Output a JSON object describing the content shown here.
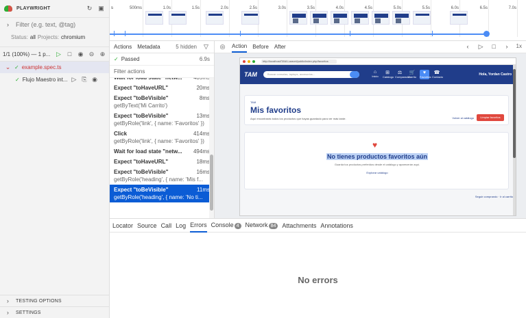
{
  "sidebar": {
    "title": "PLAYWRIGHT",
    "filter_placeholder": "Filter (e.g. text, @tag)",
    "status_label": "Status:",
    "status_value": "all",
    "projects_label": "Projects:",
    "projects_value": "chromium",
    "run_count": "1/1 (100%) — 1 p...",
    "file": "example.spec.ts",
    "test": "Flujo Maestro int...",
    "testing_options": "TESTING OPTIONS",
    "settings": "SETTINGS"
  },
  "timeline": {
    "ticks": [
      "500ms",
      "1.0s",
      "1.5s",
      "2.0s",
      "2.5s",
      "3.0s",
      "3.5s",
      "4.0s",
      "4.5s",
      "5.0s",
      "5.5s",
      "6.0s",
      "6.5s",
      "7.0s"
    ],
    "first_label": "s"
  },
  "actions_panel": {
    "tab_actions": "Actions",
    "tab_metadata": "Metadata",
    "hidden": "5 hidden",
    "passed": "Passed",
    "passed_time": "6.9s",
    "filter": "Filter actions",
    "items": [
      {
        "name": "Wait for load state \"netw...",
        "ms": "435ms",
        "sub": ""
      },
      {
        "name": "Expect \"toHaveURL\"",
        "ms": "20ms",
        "sub": ""
      },
      {
        "name": "Expect \"toBeVisible\"",
        "ms": "8ms",
        "sub": "getByText('Mi Carrito')"
      },
      {
        "name": "Expect \"toBeVisible\"",
        "ms": "13ms",
        "sub": "getByRole('link', { name: 'Favoritos' })"
      },
      {
        "name": "Click",
        "ms": "414ms",
        "sub": "getByRole('link', { name: 'Favoritos' })"
      },
      {
        "name": "Wait for load state \"netw...",
        "ms": "494ms",
        "sub": ""
      },
      {
        "name": "Expect \"toHaveURL\"",
        "ms": "18ms",
        "sub": ""
      },
      {
        "name": "Expect \"toBeVisible\"",
        "ms": "16ms",
        "sub": "getByRole('heading', { name: 'Mis f..."
      },
      {
        "name": "Expect \"toBeVisible\"",
        "ms": "11ms",
        "sub": "getByRole('heading', { name: 'No ti..."
      }
    ]
  },
  "main": {
    "tab_action": "Action",
    "tab_before": "Before",
    "tab_after": "After",
    "zoom": "1x"
  },
  "snapshot": {
    "url": "http://localhost/TAM-Laravel/public/index.php/favoritos",
    "brand": "TAM",
    "search_placeholder": "Buscar consolas, laptops, accesorios...",
    "nav": [
      "Inicio",
      "Catálogo",
      "Comparador",
      "Carrito",
      "Favoritos",
      "Contacto"
    ],
    "user": "Hola, Yordan Castro",
    "category": "TAM",
    "heading": "Mis favoritos",
    "subheading": "Aquí encontrarás todos los productos que hayas guardado para ver más tarde.",
    "back_link": "Volver al catálogo",
    "clear_button": "Limpiar favoritos",
    "empty_title": "No tienes productos favoritos aún",
    "empty_sub": "Guarda tus productos preferidos desde el catálogo y aparecerán aquí.",
    "explore": "Explorar catálogo",
    "continue": "Seguir comprando",
    "cart": "Ir al carrito"
  },
  "bottom": {
    "tabs": [
      "Locator",
      "Source",
      "Call",
      "Log",
      "Errors",
      "Console",
      "Network",
      "Attachments",
      "Annotations"
    ],
    "console_count": "4",
    "network_count": "84",
    "empty": "No errors"
  }
}
